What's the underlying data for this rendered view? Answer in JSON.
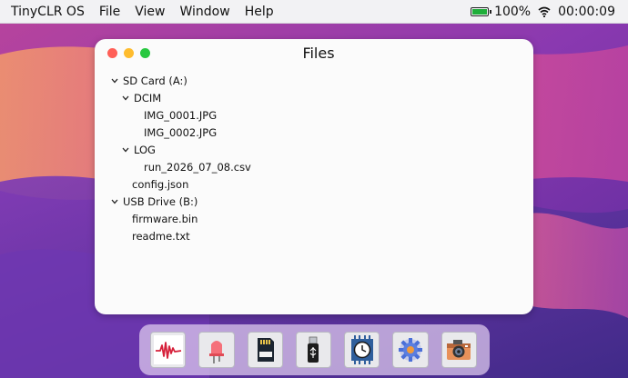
{
  "menubar": {
    "app_name": "TinyCLR OS",
    "menus": [
      "File",
      "View",
      "Window",
      "Help"
    ],
    "battery_percent": "100%",
    "battery_level": 1.0,
    "clock": "00:00:09"
  },
  "window": {
    "title": "Files",
    "tree": {
      "sd_card": "SD Card (A:)",
      "dcim": "DCIM",
      "img1": "IMG_0001.JPG",
      "img2": "IMG_0002.JPG",
      "log": "LOG",
      "csv": "run_2026_07_08.csv",
      "config": "config.json",
      "usb": "USB Drive (B:)",
      "firmware": "firmware.bin",
      "readme": "readme.txt"
    }
  },
  "dock": {
    "icons": [
      "waveform-icon",
      "led-icon",
      "sd-card-icon",
      "usb-drive-icon",
      "clock-chip-icon",
      "settings-gear-icon",
      "camera-icon"
    ]
  },
  "colors": {
    "battery_fill": "#1fae3a",
    "wallpaper_base": "#6b2fa6",
    "wallpaper_pink": "#e0579a",
    "wallpaper_orange": "#f09a5a"
  }
}
